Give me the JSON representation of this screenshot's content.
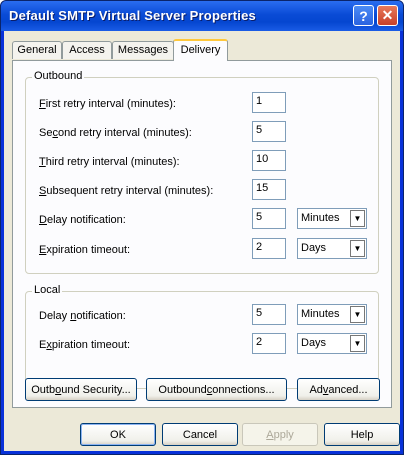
{
  "window": {
    "title": "Default SMTP Virtual Server Properties"
  },
  "titlebar_buttons": {
    "help": "?",
    "close": "✕"
  },
  "tabs": [
    {
      "label": "General",
      "active": false
    },
    {
      "label": "Access",
      "active": false
    },
    {
      "label": "Messages",
      "active": false
    },
    {
      "label": "Delivery",
      "active": true
    }
  ],
  "outbound": {
    "legend": "Outbound",
    "first_retry": {
      "label_pre": "",
      "mnemonic": "F",
      "label_post": "irst retry interval (minutes):",
      "value": "1"
    },
    "second_retry": {
      "label_pre": "Se",
      "mnemonic": "c",
      "label_post": "ond retry interval (minutes):",
      "value": "5"
    },
    "third_retry": {
      "label_pre": "",
      "mnemonic": "T",
      "label_post": "hird retry interval (minutes):",
      "value": "10"
    },
    "subsequent_retry": {
      "label_pre": "",
      "mnemonic": "S",
      "label_post": "ubsequent retry interval (minutes):",
      "value": "15"
    },
    "delay_notification": {
      "label_pre": "",
      "mnemonic": "D",
      "label_post": "elay notification:",
      "value": "5",
      "unit": "Minutes"
    },
    "expiration_timeout": {
      "label_pre": "",
      "mnemonic": "E",
      "label_post": "xpiration timeout:",
      "value": "2",
      "unit": "Days"
    }
  },
  "local": {
    "legend": "Local",
    "delay_notification": {
      "label_pre": "Delay ",
      "mnemonic": "n",
      "label_post": "otification:",
      "value": "5",
      "unit": "Minutes"
    },
    "expiration_timeout": {
      "label_pre": "E",
      "mnemonic": "x",
      "label_post": "piration timeout:",
      "value": "2",
      "unit": "Days"
    }
  },
  "panel_buttons": {
    "outbound_security": {
      "pre": "Outb",
      "mn": "o",
      "post": "und Security..."
    },
    "outbound_connections": {
      "pre": "Outbound ",
      "mn": "c",
      "post": "onnections..."
    },
    "advanced": {
      "pre": "Ad",
      "mn": "v",
      "post": "anced..."
    }
  },
  "dialog_buttons": {
    "ok": "OK",
    "cancel": "Cancel",
    "apply": {
      "pre": "",
      "mn": "A",
      "post": "pply"
    },
    "help": "Help"
  }
}
